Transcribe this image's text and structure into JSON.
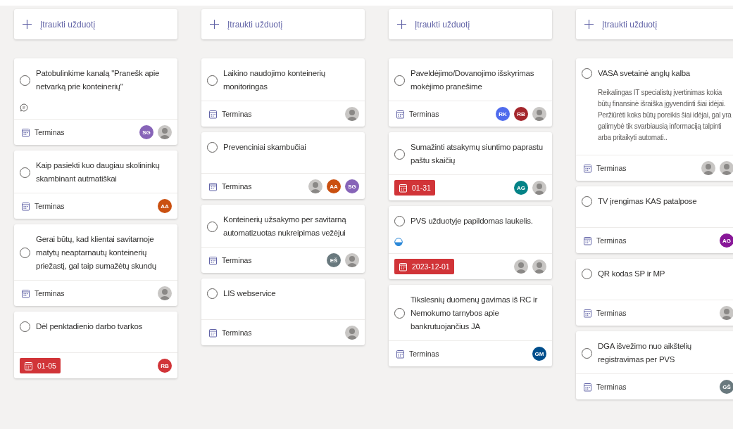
{
  "columns": [
    {
      "add_label": "Įtraukti užduotį",
      "tasks": [
        {
          "title": "Patobulinkime kanalą \"Pranešk apie netvarką prie konteinerių\"",
          "completed": false,
          "has_comments": true,
          "due": {
            "kind": "none",
            "text": "Terminas"
          },
          "assignees": [
            {
              "kind": "initials",
              "initials": "SG",
              "color": "#8764b8"
            },
            {
              "kind": "photo"
            }
          ]
        },
        {
          "title": "Kaip pasiekti kuo daugiau skolininkų skambinant autmatiškai",
          "completed": false,
          "due": {
            "kind": "none",
            "text": "Terminas"
          },
          "assignees": [
            {
              "kind": "initials",
              "initials": "AA",
              "color": "#ca5010"
            }
          ]
        },
        {
          "title": "Gerai būtų, kad klientai savitarnoje matytų neaptarnautų konteinerių priežastį, gal taip sumažėtų skundų",
          "completed": false,
          "due": {
            "kind": "none",
            "text": "Terminas"
          },
          "assignees": [
            {
              "kind": "photo"
            }
          ]
        },
        {
          "title": "Dėl penktadienio darbo tvarkos",
          "completed": false,
          "due": {
            "kind": "overdue",
            "text": "01-05"
          },
          "assignees": [
            {
              "kind": "initials",
              "initials": "RB",
              "color": "#d13438"
            }
          ]
        }
      ]
    },
    {
      "add_label": "Įtraukti užduotį",
      "tasks": [
        {
          "title": "Laikino naudojimo konteinerių monitoringas",
          "completed": false,
          "due": {
            "kind": "none",
            "text": "Terminas"
          },
          "assignees": [
            {
              "kind": "photo"
            }
          ]
        },
        {
          "title": "Prevenciniai skambučiai",
          "completed": false,
          "due": {
            "kind": "none",
            "text": "Terminas"
          },
          "assignees": [
            {
              "kind": "photo"
            },
            {
              "kind": "initials",
              "initials": "AA",
              "color": "#ca5010"
            },
            {
              "kind": "initials",
              "initials": "SG",
              "color": "#8764b8"
            }
          ]
        },
        {
          "title": "Konteinerių užsakymo per savitarną automatizuotas nukreipimas vežėjui",
          "completed": false,
          "due": {
            "kind": "none",
            "text": "Terminas"
          },
          "assignees": [
            {
              "kind": "initials",
              "initials": "EŠ",
              "color": "#69797e"
            },
            {
              "kind": "photo"
            }
          ]
        },
        {
          "title": "LIS webservice",
          "completed": false,
          "due": {
            "kind": "none",
            "text": "Terminas"
          },
          "assignees": [
            {
              "kind": "photo"
            }
          ]
        }
      ]
    },
    {
      "add_label": "Įtraukti užduotį",
      "tasks": [
        {
          "title": "Paveldėjimo/Dovanojimo išskyrimas mokėjimo pranešime",
          "completed": false,
          "due": {
            "kind": "none",
            "text": "Terminas"
          },
          "assignees": [
            {
              "kind": "initials",
              "initials": "RK",
              "color": "#4f6bed"
            },
            {
              "kind": "initials",
              "initials": "RB",
              "color": "#a4262c"
            },
            {
              "kind": "photo"
            }
          ]
        },
        {
          "title": "Sumažinti atsakymų siuntimo paprastu paštu skaičių",
          "completed": false,
          "due": {
            "kind": "overdue",
            "text": "01-31"
          },
          "assignees": [
            {
              "kind": "initials",
              "initials": "AG",
              "color": "#038387"
            },
            {
              "kind": "photo"
            }
          ]
        },
        {
          "title": "PVS užduotyje papildomas laukelis.",
          "completed": false,
          "in_progress": true,
          "due": {
            "kind": "overdue",
            "text": "2023-12-01"
          },
          "assignees": [
            {
              "kind": "photo"
            },
            {
              "kind": "photo"
            }
          ]
        },
        {
          "title": "Tikslesnių duomenų gavimas iš RC ir Nemokumo tarnybos apie bankrutuojančius JA",
          "completed": false,
          "due": {
            "kind": "none",
            "text": "Terminas"
          },
          "assignees": [
            {
              "kind": "initials",
              "initials": "GM",
              "color": "#004e8c"
            }
          ]
        }
      ]
    },
    {
      "add_label": "Įtraukti užduotį",
      "tasks": [
        {
          "title": "VASA svetainė anglų kalba",
          "completed": false,
          "description": "Reikalingas IT specialistų įvertinimas kokia būtų finansinė išraiška  įgyvendinti šiai idėjai. Peržiūrėti koks būtų poreikis šiai idėjai, gal yra galimybė tik svarbiausią informaciją talpinti arba pritaikyti automati..",
          "due": {
            "kind": "none",
            "text": "Terminas"
          },
          "assignees": [
            {
              "kind": "photo"
            },
            {
              "kind": "photo"
            }
          ]
        },
        {
          "title": "TV įrengimas KAS patalpose",
          "completed": false,
          "due": {
            "kind": "none",
            "text": "Terminas"
          },
          "assignees": [
            {
              "kind": "initials",
              "initials": "AG",
              "color": "#881798"
            }
          ]
        },
        {
          "title": "QR kodas SP ir MP",
          "completed": false,
          "due": {
            "kind": "none",
            "text": "Terminas"
          },
          "assignees": [
            {
              "kind": "photo"
            }
          ]
        },
        {
          "title": "DGA išvežimo nuo aikštelių registravimas per PVS",
          "completed": false,
          "due": {
            "kind": "none",
            "text": "Terminas"
          },
          "assignees": [
            {
              "kind": "initials",
              "initials": "GŠ",
              "color": "#69797e"
            }
          ]
        }
      ]
    }
  ]
}
